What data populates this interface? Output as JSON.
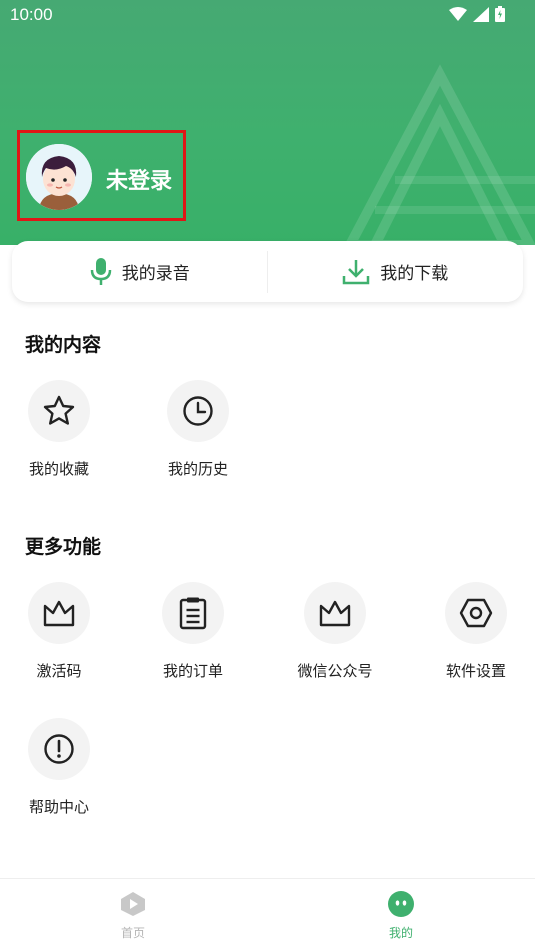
{
  "status_bar": {
    "time": "10:00"
  },
  "profile": {
    "name": "未登录"
  },
  "quick_actions": [
    {
      "label": "我的录音",
      "icon": "microphone-icon"
    },
    {
      "label": "我的下载",
      "icon": "download-icon"
    }
  ],
  "my_content": {
    "title": "我的内容",
    "items": [
      {
        "label": "我的收藏",
        "icon": "star-icon"
      },
      {
        "label": "我的历史",
        "icon": "clock-icon"
      }
    ]
  },
  "more_features": {
    "title": "更多功能",
    "items": [
      {
        "label": "激活码",
        "icon": "crown-icon"
      },
      {
        "label": "我的订单",
        "icon": "clipboard-icon"
      },
      {
        "label": "微信公众号",
        "icon": "crown-icon"
      },
      {
        "label": "软件设置",
        "icon": "hex-gear-icon"
      },
      {
        "label": "帮助中心",
        "icon": "exclamation-icon"
      }
    ]
  },
  "bottom_nav": {
    "items": [
      {
        "label": "首页",
        "active": false
      },
      {
        "label": "我的",
        "active": true
      }
    ]
  },
  "colors": {
    "brand_green": "#3fb06e",
    "highlight_red": "#e01616",
    "inactive_gray": "#b5b5b5"
  }
}
